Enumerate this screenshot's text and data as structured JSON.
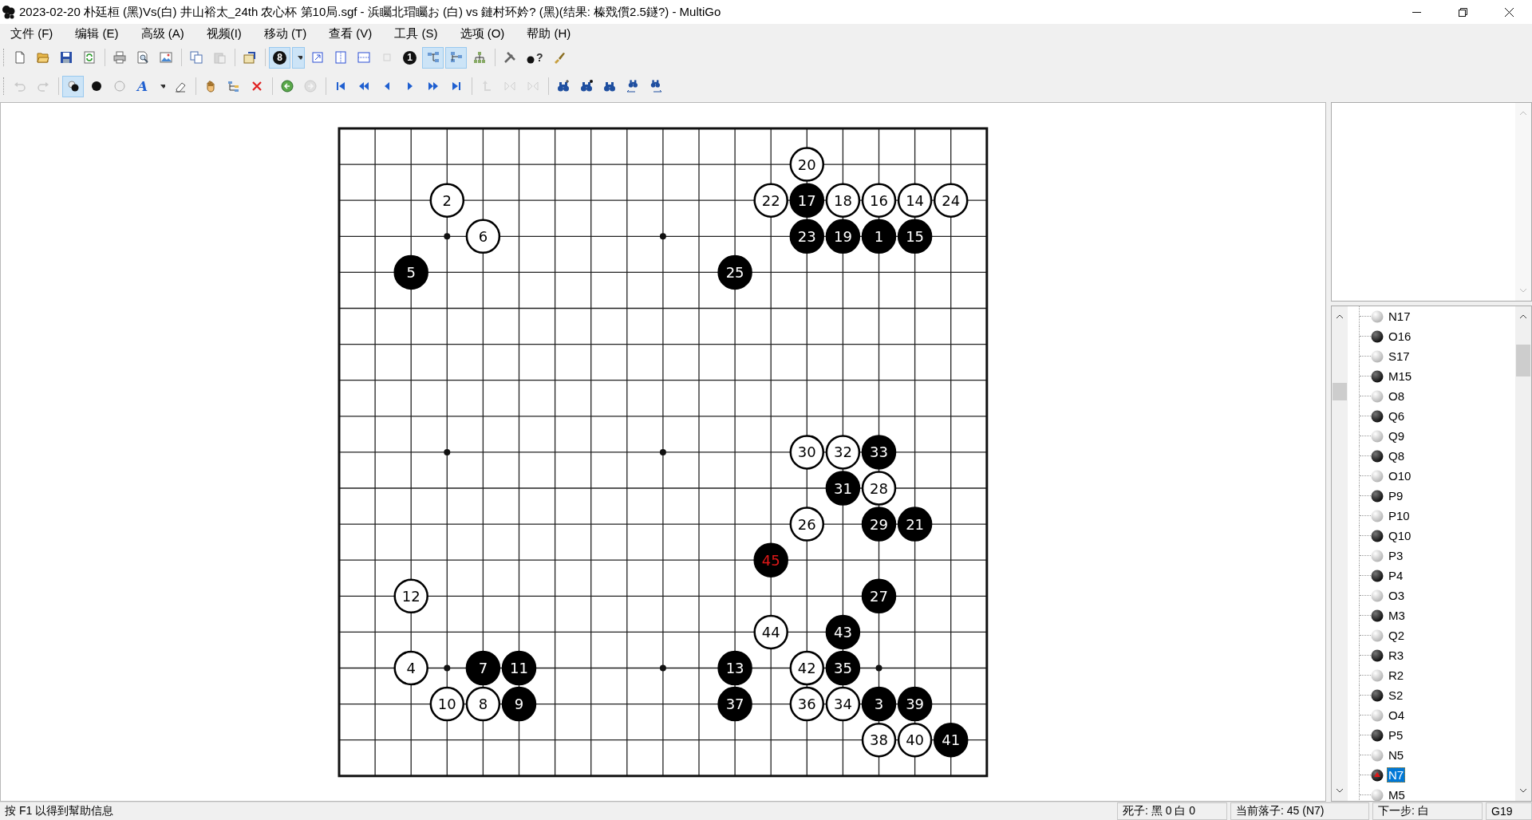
{
  "window": {
    "title": "2023-02-20 朴廷桓 (黑)Vs(白) 井山裕太_24th 农心杯 第10局.sgf - 浜矚北瑁矚お (白) vs 鏈村环妗? (黑)(结果: 榛戣儨2.5鐩?) - MultiGo"
  },
  "menu": [
    "文件 (F)",
    "编辑 (E)",
    "高级 (A)",
    "视频(I)",
    "移动 (T)",
    "查看 (V)",
    "工具 (S)",
    "选项 (O)",
    "帮助 (H)"
  ],
  "toolbars": [
    {
      "groups": [
        {
          "buttons": [
            {
              "kind": "new",
              "pressed": false,
              "disabled": false
            },
            {
              "kind": "open",
              "pressed": false,
              "disabled": false
            },
            {
              "kind": "save",
              "pressed": false,
              "disabled": false
            },
            {
              "kind": "refresh",
              "pressed": false,
              "disabled": false
            }
          ]
        },
        {
          "buttons": [
            {
              "kind": "print",
              "pressed": false,
              "disabled": false
            },
            {
              "kind": "preview",
              "pressed": false,
              "disabled": false
            },
            {
              "kind": "image",
              "pressed": false,
              "disabled": false
            }
          ]
        },
        {
          "buttons": [
            {
              "kind": "copy",
              "pressed": false,
              "disabled": false
            },
            {
              "kind": "paste",
              "pressed": false,
              "disabled": true
            }
          ]
        },
        {
          "buttons": [
            {
              "kind": "properties",
              "pressed": false,
              "disabled": false
            }
          ]
        },
        {
          "buttons": [
            {
              "kind": "number",
              "label": "8",
              "pressed": true,
              "disabled": false
            },
            {
              "kind": "dropdown",
              "pressed": true,
              "disabled": false
            },
            {
              "kind": "arrow-box",
              "pressed": false,
              "disabled": false
            },
            {
              "kind": "split-v",
              "pressed": false,
              "disabled": false
            },
            {
              "kind": "split-h",
              "pressed": false,
              "disabled": false
            },
            {
              "kind": "square",
              "pressed": false,
              "disabled": true
            },
            {
              "kind": "number",
              "label": "1",
              "pressed": false,
              "disabled": false
            },
            {
              "kind": "tree-right",
              "pressed": true,
              "disabled": false
            },
            {
              "kind": "tree-left",
              "pressed": true,
              "disabled": false
            },
            {
              "kind": "tree-org",
              "pressed": false,
              "disabled": false
            }
          ]
        },
        {
          "buttons": [
            {
              "kind": "tools",
              "pressed": false,
              "disabled": false
            },
            {
              "kind": "help",
              "label": "?",
              "pressed": false,
              "disabled": false
            },
            {
              "kind": "brush",
              "pressed": false,
              "disabled": false
            }
          ]
        }
      ]
    },
    {
      "groups": [
        {
          "buttons": [
            {
              "kind": "undo",
              "pressed": false,
              "disabled": true
            },
            {
              "kind": "redo",
              "pressed": false,
              "disabled": true
            }
          ]
        },
        {
          "buttons": [
            {
              "kind": "alternate",
              "pressed": true,
              "disabled": false
            },
            {
              "kind": "black",
              "pressed": false,
              "disabled": false
            },
            {
              "kind": "white",
              "pressed": false,
              "disabled": false
            },
            {
              "kind": "letter",
              "label": "A",
              "pressed": false,
              "disabled": false
            },
            {
              "kind": "dropdown",
              "pressed": false,
              "disabled": false
            },
            {
              "kind": "eraser",
              "pressed": false,
              "disabled": false
            }
          ]
        },
        {
          "buttons": [
            {
              "kind": "hand",
              "pressed": false,
              "disabled": false
            },
            {
              "kind": "add-node",
              "pressed": false,
              "disabled": false
            },
            {
              "kind": "delete",
              "pressed": false,
              "disabled": false
            }
          ]
        },
        {
          "buttons": [
            {
              "kind": "green-circle",
              "pressed": false,
              "disabled": false
            },
            {
              "kind": "grey-circle",
              "pressed": false,
              "disabled": true
            }
          ]
        },
        {
          "buttons": [
            {
              "kind": "first",
              "pressed": false,
              "disabled": false
            },
            {
              "kind": "fast-back",
              "pressed": false,
              "disabled": false
            },
            {
              "kind": "back",
              "pressed": false,
              "disabled": false
            },
            {
              "kind": "forward",
              "pressed": false,
              "disabled": false
            },
            {
              "kind": "fast-forward",
              "pressed": false,
              "disabled": false
            },
            {
              "kind": "last",
              "pressed": false,
              "disabled": false
            }
          ]
        },
        {
          "buttons": [
            {
              "kind": "up",
              "pressed": false,
              "disabled": true
            },
            {
              "kind": "mirror",
              "pressed": false,
              "disabled": true
            },
            {
              "kind": "mirror",
              "pressed": false,
              "disabled": true
            }
          ]
        },
        {
          "buttons": [
            {
              "kind": "find-plus",
              "pressed": false,
              "disabled": false
            },
            {
              "kind": "find-dot",
              "pressed": false,
              "disabled": false
            },
            {
              "kind": "find",
              "pressed": false,
              "disabled": false
            },
            {
              "kind": "find-left",
              "pressed": false,
              "disabled": false
            },
            {
              "kind": "find-right",
              "pressed": false,
              "disabled": false
            }
          ]
        }
      ]
    }
  ],
  "board": {
    "rows": [
      {},
      {
        "cells": [
          {
            "kind": "empty"
          },
          {
            "kind": "empty"
          },
          {
            "kind": "empty"
          },
          {
            "kind": "empty"
          },
          {
            "kind": "empty"
          },
          {
            "kind": "empty"
          },
          {
            "kind": "empty"
          },
          {
            "kind": "empty"
          },
          {
            "kind": "empty"
          },
          {
            "kind": "empty"
          },
          {
            "kind": "empty"
          },
          {
            "kind": "empty"
          },
          {
            "kind": "empty"
          },
          {
            "kind": "white",
            "number": "20",
            "last": false
          }
        ]
      },
      {
        "cells": [
          {
            "kind": "empty"
          },
          {
            "kind": "empty"
          },
          {
            "kind": "empty"
          },
          {
            "kind": "white",
            "number": "2",
            "last": false
          },
          {
            "kind": "empty"
          },
          {
            "kind": "empty"
          },
          {
            "kind": "empty"
          },
          {
            "kind": "empty"
          },
          {
            "kind": "empty"
          },
          {
            "kind": "empty"
          },
          {
            "kind": "empty"
          },
          {
            "kind": "empty"
          },
          {
            "kind": "white",
            "number": "22",
            "last": false
          },
          {
            "kind": "black",
            "number": "17",
            "last": false
          },
          {
            "kind": "white",
            "number": "18",
            "last": false
          },
          {
            "kind": "white",
            "number": "16",
            "last": false
          },
          {
            "kind": "white",
            "number": "14",
            "last": false
          },
          {
            "kind": "white",
            "number": "24",
            "last": false
          }
        ]
      },
      {
        "cells": [
          {
            "kind": "empty"
          },
          {
            "kind": "empty"
          },
          {
            "kind": "empty"
          },
          {
            "kind": "empty"
          },
          {
            "kind": "white",
            "number": "6",
            "last": false
          },
          {
            "kind": "empty"
          },
          {
            "kind": "empty"
          },
          {
            "kind": "empty"
          },
          {
            "kind": "empty"
          },
          {
            "kind": "empty"
          },
          {
            "kind": "empty"
          },
          {
            "kind": "empty"
          },
          {
            "kind": "empty"
          },
          {
            "kind": "black",
            "number": "23",
            "last": false
          },
          {
            "kind": "black",
            "number": "19",
            "last": false
          },
          {
            "kind": "black",
            "number": "1",
            "last": false
          },
          {
            "kind": "black",
            "number": "15",
            "last": false
          }
        ]
      },
      {
        "cells": [
          {
            "kind": "empty"
          },
          {
            "kind": "empty"
          },
          {
            "kind": "black",
            "number": "5",
            "last": false
          },
          {
            "kind": "empty"
          },
          {
            "kind": "empty"
          },
          {
            "kind": "empty"
          },
          {
            "kind": "empty"
          },
          {
            "kind": "empty"
          },
          {
            "kind": "empty"
          },
          {
            "kind": "empty"
          },
          {
            "kind": "empty"
          },
          {
            "kind": "black",
            "number": "25",
            "last": false
          }
        ]
      },
      {},
      {},
      {},
      {},
      {
        "cells": [
          {
            "kind": "empty"
          },
          {
            "kind": "empty"
          },
          {
            "kind": "empty"
          },
          {
            "kind": "empty"
          },
          {
            "kind": "empty"
          },
          {
            "kind": "empty"
          },
          {
            "kind": "empty"
          },
          {
            "kind": "empty"
          },
          {
            "kind": "empty"
          },
          {
            "kind": "empty"
          },
          {
            "kind": "empty"
          },
          {
            "kind": "empty"
          },
          {
            "kind": "empty"
          },
          {
            "kind": "white",
            "number": "30",
            "last": false
          },
          {
            "kind": "white",
            "number": "32",
            "last": false
          },
          {
            "kind": "black",
            "number": "33",
            "last": false
          }
        ]
      },
      {
        "cells": [
          {
            "kind": "empty"
          },
          {
            "kind": "empty"
          },
          {
            "kind": "empty"
          },
          {
            "kind": "empty"
          },
          {
            "kind": "empty"
          },
          {
            "kind": "empty"
          },
          {
            "kind": "empty"
          },
          {
            "kind": "empty"
          },
          {
            "kind": "empty"
          },
          {
            "kind": "empty"
          },
          {
            "kind": "empty"
          },
          {
            "kind": "empty"
          },
          {
            "kind": "empty"
          },
          {
            "kind": "empty"
          },
          {
            "kind": "black",
            "number": "31",
            "last": false
          },
          {
            "kind": "white",
            "number": "28",
            "last": false
          }
        ]
      },
      {
        "cells": [
          {
            "kind": "empty"
          },
          {
            "kind": "empty"
          },
          {
            "kind": "empty"
          },
          {
            "kind": "empty"
          },
          {
            "kind": "empty"
          },
          {
            "kind": "empty"
          },
          {
            "kind": "empty"
          },
          {
            "kind": "empty"
          },
          {
            "kind": "empty"
          },
          {
            "kind": "empty"
          },
          {
            "kind": "empty"
          },
          {
            "kind": "empty"
          },
          {
            "kind": "empty"
          },
          {
            "kind": "white",
            "number": "26",
            "last": false
          },
          {
            "kind": "empty"
          },
          {
            "kind": "black",
            "number": "29",
            "last": false
          },
          {
            "kind": "black",
            "number": "21",
            "last": false
          }
        ]
      },
      {
        "cells": [
          {
            "kind": "empty"
          },
          {
            "kind": "empty"
          },
          {
            "kind": "empty"
          },
          {
            "kind": "empty"
          },
          {
            "kind": "empty"
          },
          {
            "kind": "empty"
          },
          {
            "kind": "empty"
          },
          {
            "kind": "empty"
          },
          {
            "kind": "empty"
          },
          {
            "kind": "empty"
          },
          {
            "kind": "empty"
          },
          {
            "kind": "empty"
          },
          {
            "kind": "black",
            "number": "45",
            "last": true
          }
        ]
      },
      {
        "cells": [
          {
            "kind": "empty"
          },
          {
            "kind": "empty"
          },
          {
            "kind": "white",
            "number": "12",
            "last": false
          },
          {
            "kind": "empty"
          },
          {
            "kind": "empty"
          },
          {
            "kind": "empty"
          },
          {
            "kind": "empty"
          },
          {
            "kind": "empty"
          },
          {
            "kind": "empty"
          },
          {
            "kind": "empty"
          },
          {
            "kind": "empty"
          },
          {
            "kind": "empty"
          },
          {
            "kind": "empty"
          },
          {
            "kind": "empty"
          },
          {
            "kind": "empty"
          },
          {
            "kind": "black",
            "number": "27",
            "last": false
          }
        ]
      },
      {
        "cells": [
          {
            "kind": "empty"
          },
          {
            "kind": "empty"
          },
          {
            "kind": "empty"
          },
          {
            "kind": "empty"
          },
          {
            "kind": "empty"
          },
          {
            "kind": "empty"
          },
          {
            "kind": "empty"
          },
          {
            "kind": "empty"
          },
          {
            "kind": "empty"
          },
          {
            "kind": "empty"
          },
          {
            "kind": "empty"
          },
          {
            "kind": "empty"
          },
          {
            "kind": "white",
            "number": "44",
            "last": false
          },
          {
            "kind": "empty"
          },
          {
            "kind": "black",
            "number": "43",
            "last": false
          }
        ]
      },
      {
        "cells": [
          {
            "kind": "empty"
          },
          {
            "kind": "empty"
          },
          {
            "kind": "white",
            "number": "4",
            "last": false
          },
          {
            "kind": "empty"
          },
          {
            "kind": "black",
            "number": "7",
            "last": false
          },
          {
            "kind": "black",
            "number": "11",
            "last": false
          },
          {
            "kind": "empty"
          },
          {
            "kind": "empty"
          },
          {
            "kind": "empty"
          },
          {
            "kind": "empty"
          },
          {
            "kind": "empty"
          },
          {
            "kind": "black",
            "number": "13",
            "last": false
          },
          {
            "kind": "empty"
          },
          {
            "kind": "white",
            "number": "42",
            "last": false
          },
          {
            "kind": "black",
            "number": "35",
            "last": false
          }
        ]
      },
      {
        "cells": [
          {
            "kind": "empty"
          },
          {
            "kind": "empty"
          },
          {
            "kind": "empty"
          },
          {
            "kind": "white",
            "number": "10",
            "last": false
          },
          {
            "kind": "white",
            "number": "8",
            "last": false
          },
          {
            "kind": "black",
            "number": "9",
            "last": false
          },
          {
            "kind": "empty"
          },
          {
            "kind": "empty"
          },
          {
            "kind": "empty"
          },
          {
            "kind": "empty"
          },
          {
            "kind": "empty"
          },
          {
            "kind": "black",
            "number": "37",
            "last": false
          },
          {
            "kind": "empty"
          },
          {
            "kind": "white",
            "number": "36",
            "last": false
          },
          {
            "kind": "white",
            "number": "34",
            "last": false
          },
          {
            "kind": "black",
            "number": "3",
            "last": false
          },
          {
            "kind": "black",
            "number": "39",
            "last": false
          }
        ]
      },
      {
        "cells": [
          {
            "kind": "empty"
          },
          {
            "kind": "empty"
          },
          {
            "kind": "empty"
          },
          {
            "kind": "empty"
          },
          {
            "kind": "empty"
          },
          {
            "kind": "empty"
          },
          {
            "kind": "empty"
          },
          {
            "kind": "empty"
          },
          {
            "kind": "empty"
          },
          {
            "kind": "empty"
          },
          {
            "kind": "empty"
          },
          {
            "kind": "empty"
          },
          {
            "kind": "empty"
          },
          {
            "kind": "empty"
          },
          {
            "kind": "empty"
          },
          {
            "kind": "white",
            "number": "38",
            "last": false
          },
          {
            "kind": "white",
            "number": "40",
            "last": false
          },
          {
            "kind": "black",
            "number": "41",
            "last": false
          }
        ]
      },
      {}
    ]
  },
  "moves": [
    {
      "label": "N17",
      "kind": "white",
      "selected": false
    },
    {
      "label": "O16",
      "kind": "black",
      "selected": false
    },
    {
      "label": "S17",
      "kind": "white",
      "selected": false
    },
    {
      "label": "M15",
      "kind": "black",
      "selected": false
    },
    {
      "label": "O8",
      "kind": "white",
      "selected": false
    },
    {
      "label": "Q6",
      "kind": "black",
      "selected": false
    },
    {
      "label": "Q9",
      "kind": "white",
      "selected": false
    },
    {
      "label": "Q8",
      "kind": "black",
      "selected": false
    },
    {
      "label": "O10",
      "kind": "white",
      "selected": false
    },
    {
      "label": "P9",
      "kind": "black",
      "selected": false
    },
    {
      "label": "P10",
      "kind": "white",
      "selected": false
    },
    {
      "label": "Q10",
      "kind": "black",
      "selected": false
    },
    {
      "label": "P3",
      "kind": "white",
      "selected": false
    },
    {
      "label": "P4",
      "kind": "black",
      "selected": false
    },
    {
      "label": "O3",
      "kind": "white",
      "selected": false
    },
    {
      "label": "M3",
      "kind": "black",
      "selected": false
    },
    {
      "label": "Q2",
      "kind": "white",
      "selected": false
    },
    {
      "label": "R3",
      "kind": "black",
      "selected": false
    },
    {
      "label": "R2",
      "kind": "white",
      "selected": false
    },
    {
      "label": "S2",
      "kind": "black",
      "selected": false
    },
    {
      "label": "O4",
      "kind": "white",
      "selected": false
    },
    {
      "label": "P5",
      "kind": "black",
      "selected": false
    },
    {
      "label": "N5",
      "kind": "white",
      "selected": false
    },
    {
      "label": "N7",
      "kind": "black",
      "selected": true
    },
    {
      "label": "M5",
      "kind": "white",
      "selected": false
    }
  ],
  "status_bar": [
    "按 F1 以得到幫助信息",
    "死子: 黑 0 白 0",
    "当前落子: 45 (N7)",
    "下一步: 白",
    "G19"
  ]
}
